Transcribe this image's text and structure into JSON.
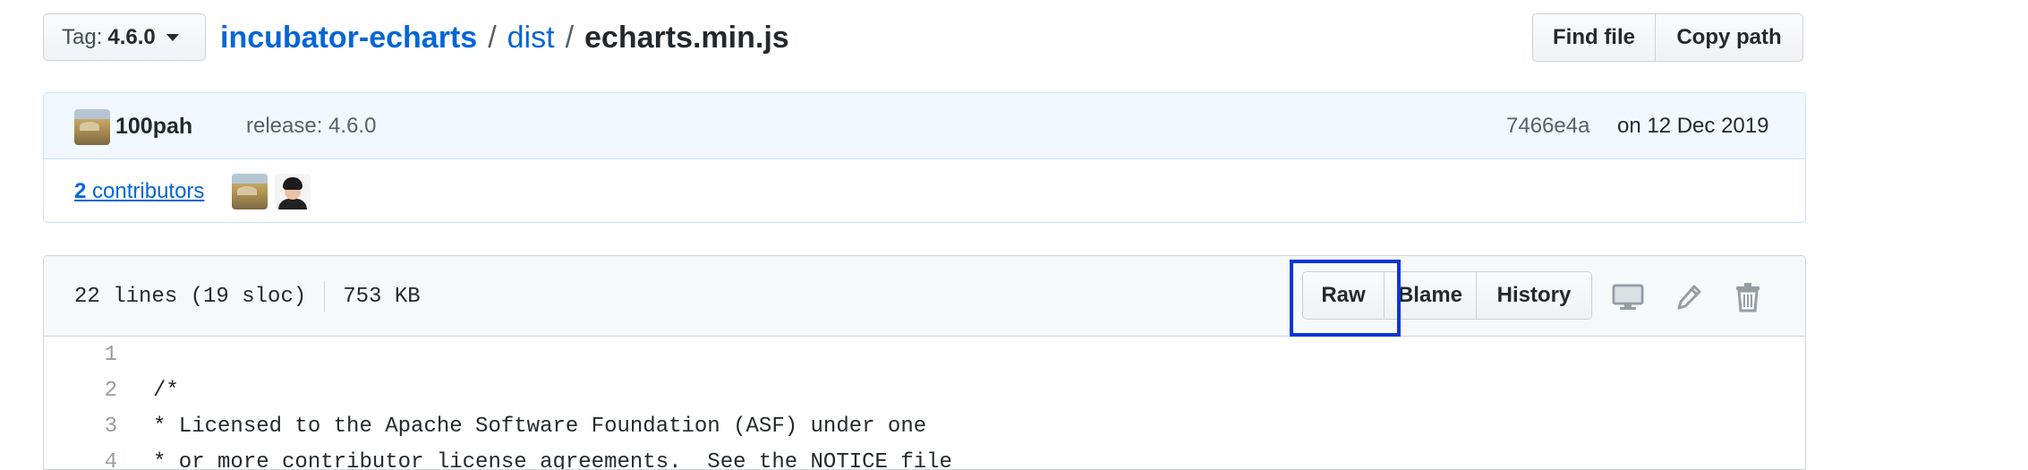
{
  "tag_select": {
    "prefix": "Tag:",
    "value": "4.6.0"
  },
  "breadcrumb": {
    "repo": "incubator-echarts",
    "sep1": "/",
    "folder": "dist",
    "sep2": "/",
    "file": "echarts.min.js"
  },
  "top_actions": {
    "find_file": "Find file",
    "copy_path": "Copy path"
  },
  "commit": {
    "author": "100pah",
    "message": "release: 4.6.0",
    "sha": "7466e4a",
    "date": "on 12 Dec 2019"
  },
  "contributors": {
    "count": "2",
    "label": "contributors"
  },
  "file_info": {
    "lines": "22 lines (19 sloc)",
    "size": "753 KB"
  },
  "file_actions": {
    "raw": "Raw",
    "blame": "Blame",
    "history": "History"
  },
  "icons": [
    "desktop-icon",
    "pencil-icon",
    "trash-icon"
  ],
  "code_lines": [
    {
      "num": "1",
      "text": ""
    },
    {
      "num": "2",
      "text": "/*"
    },
    {
      "num": "3",
      "text": "* Licensed to the Apache Software Foundation (ASF) under one"
    },
    {
      "num": "4",
      "text": "* or more contributor license agreements.  See the NOTICE file"
    }
  ],
  "colors": {
    "link": "#0366d6",
    "highlight": "#0a35d8",
    "commit_bg": "#f1f8ff"
  }
}
